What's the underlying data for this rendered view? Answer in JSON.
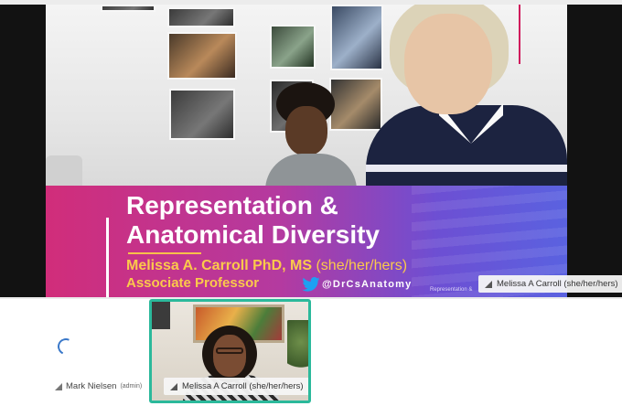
{
  "slide": {
    "title_line1": "Representation &",
    "title_line2": "Anatomical Diversity",
    "author": "Melissa A. Carroll PhD, MS",
    "pronouns": "(she/her/hers)",
    "role": "Associate Professor",
    "twitter_handle": "@DrCsAnatomy",
    "footer_note": "Representation &",
    "colors": {
      "banner_start": "#d12d7a",
      "banner_end": "#5a62e0",
      "title": "#ffffff",
      "subtitle": "#fbc94b"
    }
  },
  "share": {
    "presenter_label": "Melissa A Carroll (she/her/hers)"
  },
  "participants": [
    {
      "name": "Mark Nielsen",
      "role": "(admin)",
      "status": "loading",
      "icon": "signal-icon"
    },
    {
      "name": "Melissa A Carroll (she/her/hers)",
      "status": "speaking",
      "icon": "signal-icon",
      "highlight_color": "#2bb99b"
    }
  ]
}
